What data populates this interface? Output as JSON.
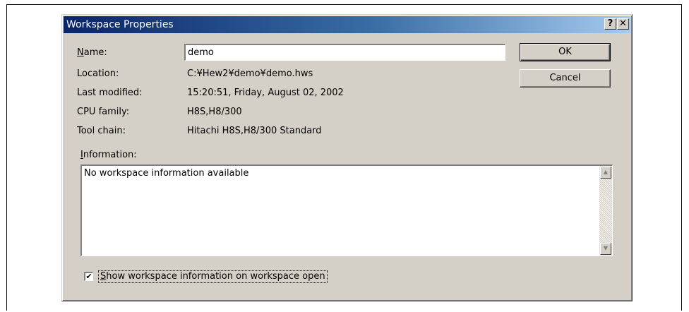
{
  "dialog": {
    "title": "Workspace Properties",
    "help_button": "?",
    "close_button": "✕"
  },
  "fields": {
    "name_label_access": "N",
    "name_label_rest": "ame:",
    "name_value": "demo",
    "location_label": "Location:",
    "location_value": "C:¥Hew2¥demo¥demo.hws",
    "last_modified_label": "Last modified:",
    "last_modified_value": "15:20:51, Friday, August 02, 2002",
    "cpu_family_label": "CPU family:",
    "cpu_family_value": "H8S,H8/300",
    "tool_chain_label": "Tool chain:",
    "tool_chain_value": "Hitachi H8S,H8/300 Standard"
  },
  "information": {
    "label_access": "I",
    "label_rest": "nformation:",
    "text": "No workspace information available",
    "scroll_up": "▲",
    "scroll_down": "▼"
  },
  "buttons": {
    "ok": "OK",
    "cancel": "Cancel"
  },
  "checkbox": {
    "checked": true,
    "mark": "✔",
    "label_access": "S",
    "label_rest": "how workspace information on workspace open"
  }
}
